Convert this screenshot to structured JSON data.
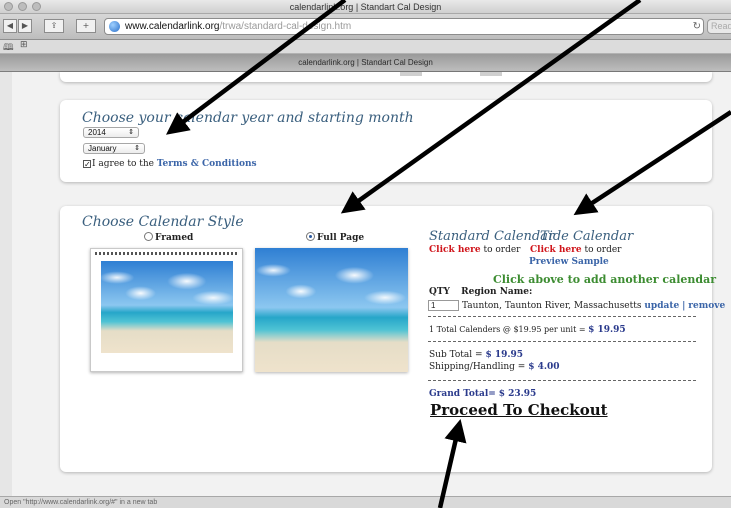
{
  "window": {
    "title": "calendarlink.org | Standart Cal Design",
    "tab_title": "calendarlink.org | Standart Cal Design"
  },
  "address": {
    "host": "www.calendarlink.org",
    "path": "/trwa/standard-cal-design.htm",
    "reader_label": "Read"
  },
  "form": {
    "heading": "Choose your calendar year and starting month",
    "year": "2014",
    "month": "January",
    "agree_prefix": "I agree to the",
    "terms_link": "Terms & Conditions",
    "agree_checked": true
  },
  "style": {
    "heading": "Choose Calendar Style",
    "option_framed": "Framed",
    "option_fullpage": "Full Page",
    "selected": "Full Page"
  },
  "order": {
    "standard_title": "Standard Calendar",
    "tide_title": "Tide Calendar",
    "click_here": "Click here",
    "to_order": "to order",
    "preview_sample": "Preview Sample",
    "add_another": "Click above to add another calendar",
    "qty_header": "QTY",
    "region_header": "Region Name:",
    "qty_value": "1",
    "region_value": "Taunton, Taunton River, Massachusetts",
    "update_link": "update",
    "separator": "|",
    "remove_link": "remove",
    "total_line_prefix": "1 Total Calenders @ $19.95 per unit =",
    "total_line_value": "$ 19.95",
    "subtotal_label": "Sub Total =",
    "subtotal_value": "$ 19.95",
    "shipping_label": "Shipping/Handling =",
    "shipping_value": "$ 4.00",
    "grand_total_label": "Grand Total=",
    "grand_total_value": "$ 23.95",
    "checkout_label": "Proceed To Checkout"
  },
  "statusbar": {
    "text": "Open \"http://www.calendarlink.org/#\" in a new tab"
  },
  "colors": {
    "heading_blue": "#3a5f7e",
    "link_blue": "#3b65a8",
    "red": "#d0151b",
    "green": "#3c8c31",
    "money": "#2a3a8c"
  },
  "icons": [
    "share-icon",
    "plus-icon",
    "globe-icon",
    "reload-icon",
    "book-icon",
    "grid-icon",
    "back-icon",
    "forward-icon"
  ]
}
